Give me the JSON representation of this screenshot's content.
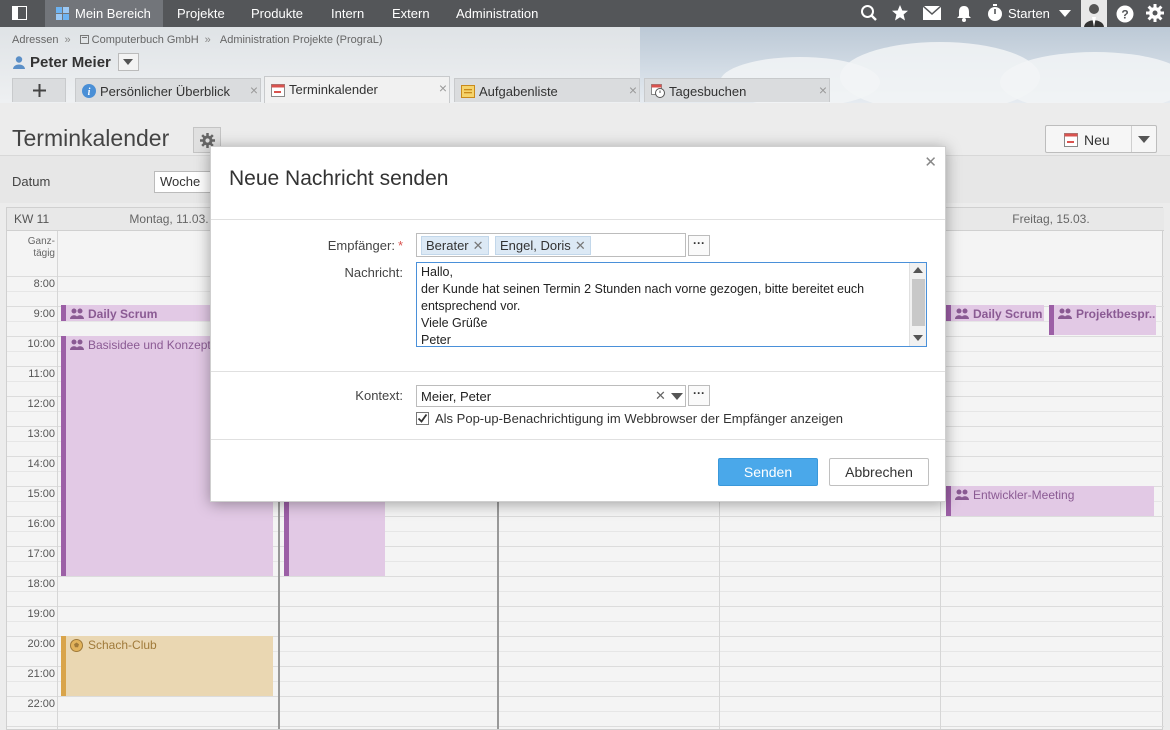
{
  "nav": {
    "items": [
      "Mein Bereich",
      "Projekte",
      "Produkte",
      "Intern",
      "Extern",
      "Administration"
    ],
    "starten_label": "Starten"
  },
  "header": {
    "breadcrumb": [
      "Adressen",
      "Computerbuch GmbH",
      "Administration Projekte (PrograL)"
    ],
    "person_name": "Peter Meier"
  },
  "tabs": [
    {
      "label": "Persönlicher Überblick",
      "icon": "info-icon"
    },
    {
      "label": "Terminkalender",
      "icon": "calendar-icon",
      "active": true
    },
    {
      "label": "Aufgabenliste",
      "icon": "tasklist-icon"
    },
    {
      "label": "Tagesbuchen",
      "icon": "timebooking-icon"
    }
  ],
  "page": {
    "title": "Terminkalender",
    "new_button": "Neu",
    "datum_label": "Datum",
    "view_select": "Woche"
  },
  "calendar": {
    "week_label": "KW 11",
    "allday_label": "Ganz-\ntägig",
    "days": [
      "Montag, 11.03.",
      "Freitag, 15.03."
    ],
    "times": [
      "8:00",
      "9:00",
      "10:00",
      "11:00",
      "12:00",
      "13:00",
      "14:00",
      "15:00",
      "16:00",
      "17:00",
      "18:00",
      "19:00",
      "20:00",
      "21:00",
      "22:00"
    ],
    "events": {
      "mon_daily": "Daily Scrum",
      "mon_basis": "Basisidee und Konzeption",
      "mon_schach": "Schach-Club",
      "fri_daily": "Daily Scrum",
      "fri_projekt": "Projektbespr...",
      "fri_entwickler": "Entwickler-Meeting"
    }
  },
  "dialog": {
    "title": "Neue Nachricht senden",
    "empfaenger_label": "Empfänger:",
    "recipients": [
      "Berater",
      "Engel, Doris"
    ],
    "nachricht_label": "Nachricht:",
    "message": "Hallo,\nder Kunde hat seinen Termin 2 Stunden nach vorne gezogen, bitte bereitet euch entsprechend vor.\nViele Grüße\nPeter",
    "kontext_label": "Kontext:",
    "kontext_value": "Meier, Peter",
    "popup_label": "Als Pop-up-Benachrichtigung im Webbrowser der Empfänger anzeigen",
    "popup_checked": true,
    "send_button": "Senden",
    "cancel_button": "Abbrechen",
    "dots": "···"
  },
  "colors": {
    "nav_bg": "#545659",
    "primary_button": "#4aa8ea",
    "event_purple": "#e2c9e5",
    "event_orange": "#ead7b2"
  }
}
